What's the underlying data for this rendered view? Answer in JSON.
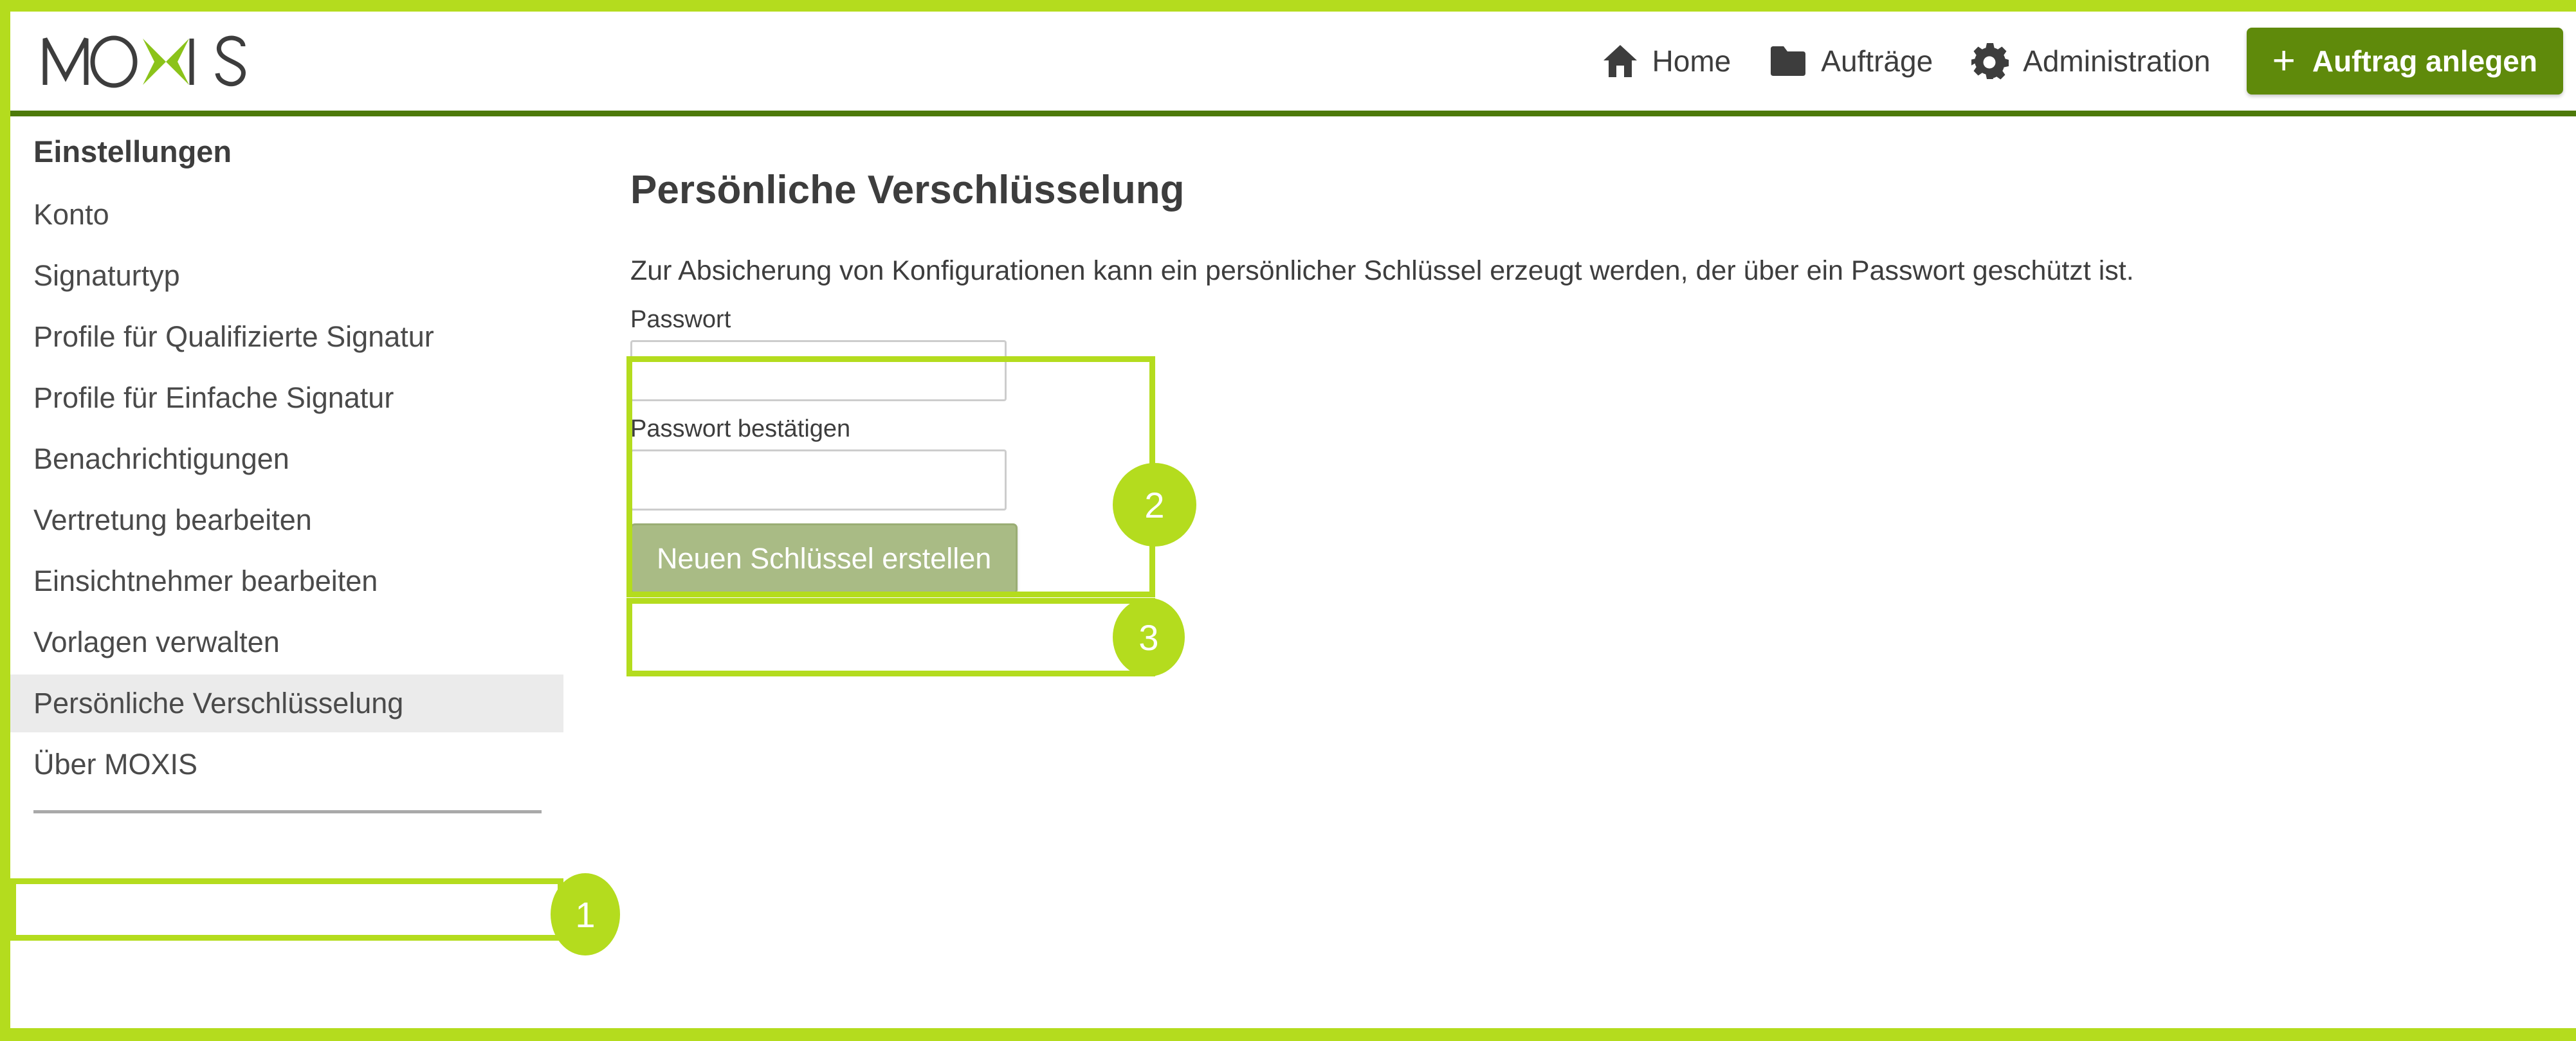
{
  "brand": {
    "logo_text": "MOXIS",
    "accent_green": "#b4dc1e",
    "dark_green": "#4d7a0a",
    "button_green": "#5f8a0b",
    "muted_button_green": "#a9bb85"
  },
  "header": {
    "nav": [
      {
        "label": "Home",
        "icon": "home-icon"
      },
      {
        "label": "Aufträge",
        "icon": "folder-icon"
      },
      {
        "label": "Administration",
        "icon": "gear-icon"
      }
    ],
    "create_order": {
      "label": "Auftrag anlegen",
      "icon": "plus-icon"
    }
  },
  "sidebar": {
    "title": "Einstellungen",
    "items": [
      {
        "label": "Konto",
        "selected": false
      },
      {
        "label": "Signaturtyp",
        "selected": false
      },
      {
        "label": "Profile für Qualifizierte Signatur",
        "selected": false
      },
      {
        "label": "Profile für Einfache Signatur",
        "selected": false
      },
      {
        "label": "Benachrichtigungen",
        "selected": false
      },
      {
        "label": "Vertretung bearbeiten",
        "selected": false
      },
      {
        "label": "Einsichtnehmer bearbeiten",
        "selected": false
      },
      {
        "label": "Vorlagen verwalten",
        "selected": false
      },
      {
        "label": "Persönliche Verschlüsselung",
        "selected": true
      },
      {
        "label": "Über MOXIS",
        "selected": false
      }
    ]
  },
  "main": {
    "title": "Persönliche Verschlüsselung",
    "description": "Zur Absicherung von Konfigurationen kann ein persönlicher Schlüssel erzeugt werden, der über ein Passwort geschützt ist.",
    "form": {
      "password_label": "Passwort",
      "password_value": "",
      "password_placeholder": "",
      "confirm_label": "Passwort bestätigen",
      "confirm_value": "",
      "confirm_placeholder": "",
      "submit_label": "Neuen Schlüssel erstellen"
    }
  },
  "annotations": [
    {
      "number": "1",
      "target": "sidebar-item-persoenliche-verschluesselung"
    },
    {
      "number": "2",
      "target": "password-fields-group"
    },
    {
      "number": "3",
      "target": "create-key-button"
    }
  ]
}
